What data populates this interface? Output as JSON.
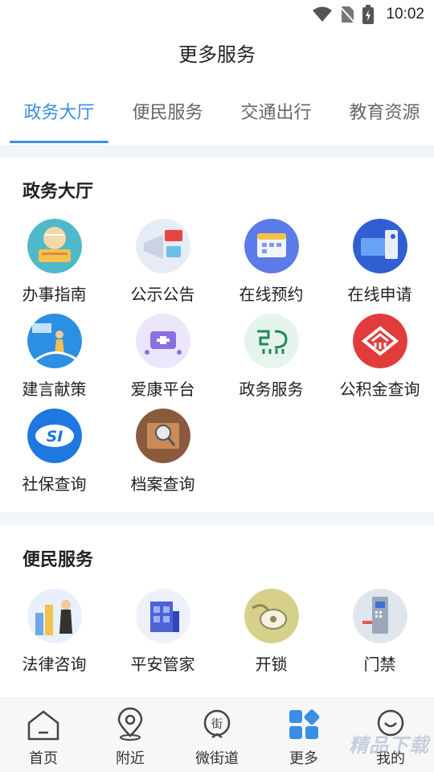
{
  "status_bar": {
    "time": "10:02"
  },
  "page_title": "更多服务",
  "tabs": [
    {
      "label": "政务大厅",
      "active": true
    },
    {
      "label": "便民服务",
      "active": false
    },
    {
      "label": "交通出行",
      "active": false
    },
    {
      "label": "教育资源",
      "active": false
    }
  ],
  "sections": {
    "gov": {
      "title": "政务大厅",
      "items": [
        {
          "label": "办事指南",
          "icon": "guide-icon"
        },
        {
          "label": "公示公告",
          "icon": "announcement-icon"
        },
        {
          "label": "在线预约",
          "icon": "appointment-icon"
        },
        {
          "label": "在线申请",
          "icon": "application-icon"
        },
        {
          "label": "建言献策",
          "icon": "suggestion-icon"
        },
        {
          "label": "爱康平台",
          "icon": "health-platform-icon"
        },
        {
          "label": "政务服务",
          "icon": "gov-service-icon"
        },
        {
          "label": "公积金查询",
          "icon": "housing-fund-icon"
        },
        {
          "label": "社保查询",
          "icon": "social-security-icon"
        },
        {
          "label": "档案查询",
          "icon": "archive-icon"
        }
      ]
    },
    "civil": {
      "title": "便民服务",
      "items": [
        {
          "label": "法律咨询",
          "icon": "legal-icon"
        },
        {
          "label": "平安管家",
          "icon": "safety-icon"
        },
        {
          "label": "开锁",
          "icon": "unlock-icon"
        },
        {
          "label": "门禁",
          "icon": "door-access-icon"
        }
      ]
    }
  },
  "bottom_nav": [
    {
      "label": "首页",
      "icon": "home-icon"
    },
    {
      "label": "附近",
      "icon": "location-icon"
    },
    {
      "label": "微街道",
      "icon": "street-icon"
    },
    {
      "label": "更多",
      "icon": "more-icon"
    },
    {
      "label": "我的",
      "icon": "profile-icon"
    }
  ],
  "watermark": "精品下载",
  "colors": {
    "accent": "#3a8ee6",
    "divider": "#f2f5f9"
  }
}
